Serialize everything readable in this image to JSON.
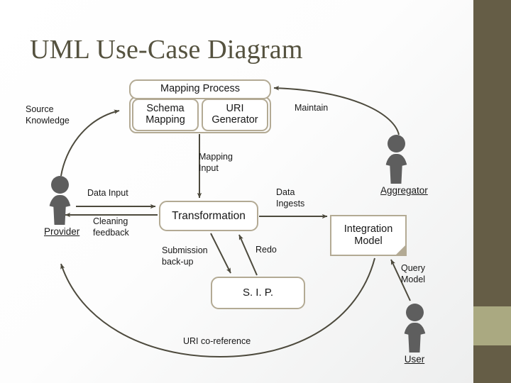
{
  "slide": {
    "title": "UML Use-Case Diagram",
    "background_color": "#ffffff",
    "accent_dark": "#655d46",
    "accent_sage": "#aaa981",
    "box_border_color": "#b3aa94",
    "actor_color": "#5e5e5e",
    "connector_color": "#4d4a3d"
  },
  "boxes": {
    "mapping_process": "Mapping Process",
    "schema_mapping": "Schema\nMapping",
    "uri_generator": "URI\nGenerator",
    "transformation": "Transformation",
    "sip": "S. I. P.",
    "integration_model": "Integration\nModel"
  },
  "actors": {
    "provider": "Provider",
    "aggregator": "Aggregator",
    "user": "User"
  },
  "edges": {
    "source_knowledge": "Source\nKnowledge",
    "maintain": "Maintain",
    "mapping_input": "Mapping\nInput",
    "data_input": "Data Input",
    "cleaning_feedback": "Cleaning\nfeedback",
    "data_ingests": "Data\nIngests",
    "submission_backup": "Submission\nback-up",
    "redo": "Redo",
    "query_model": "Query\nModel",
    "uri_coreference": "URI co-reference"
  }
}
